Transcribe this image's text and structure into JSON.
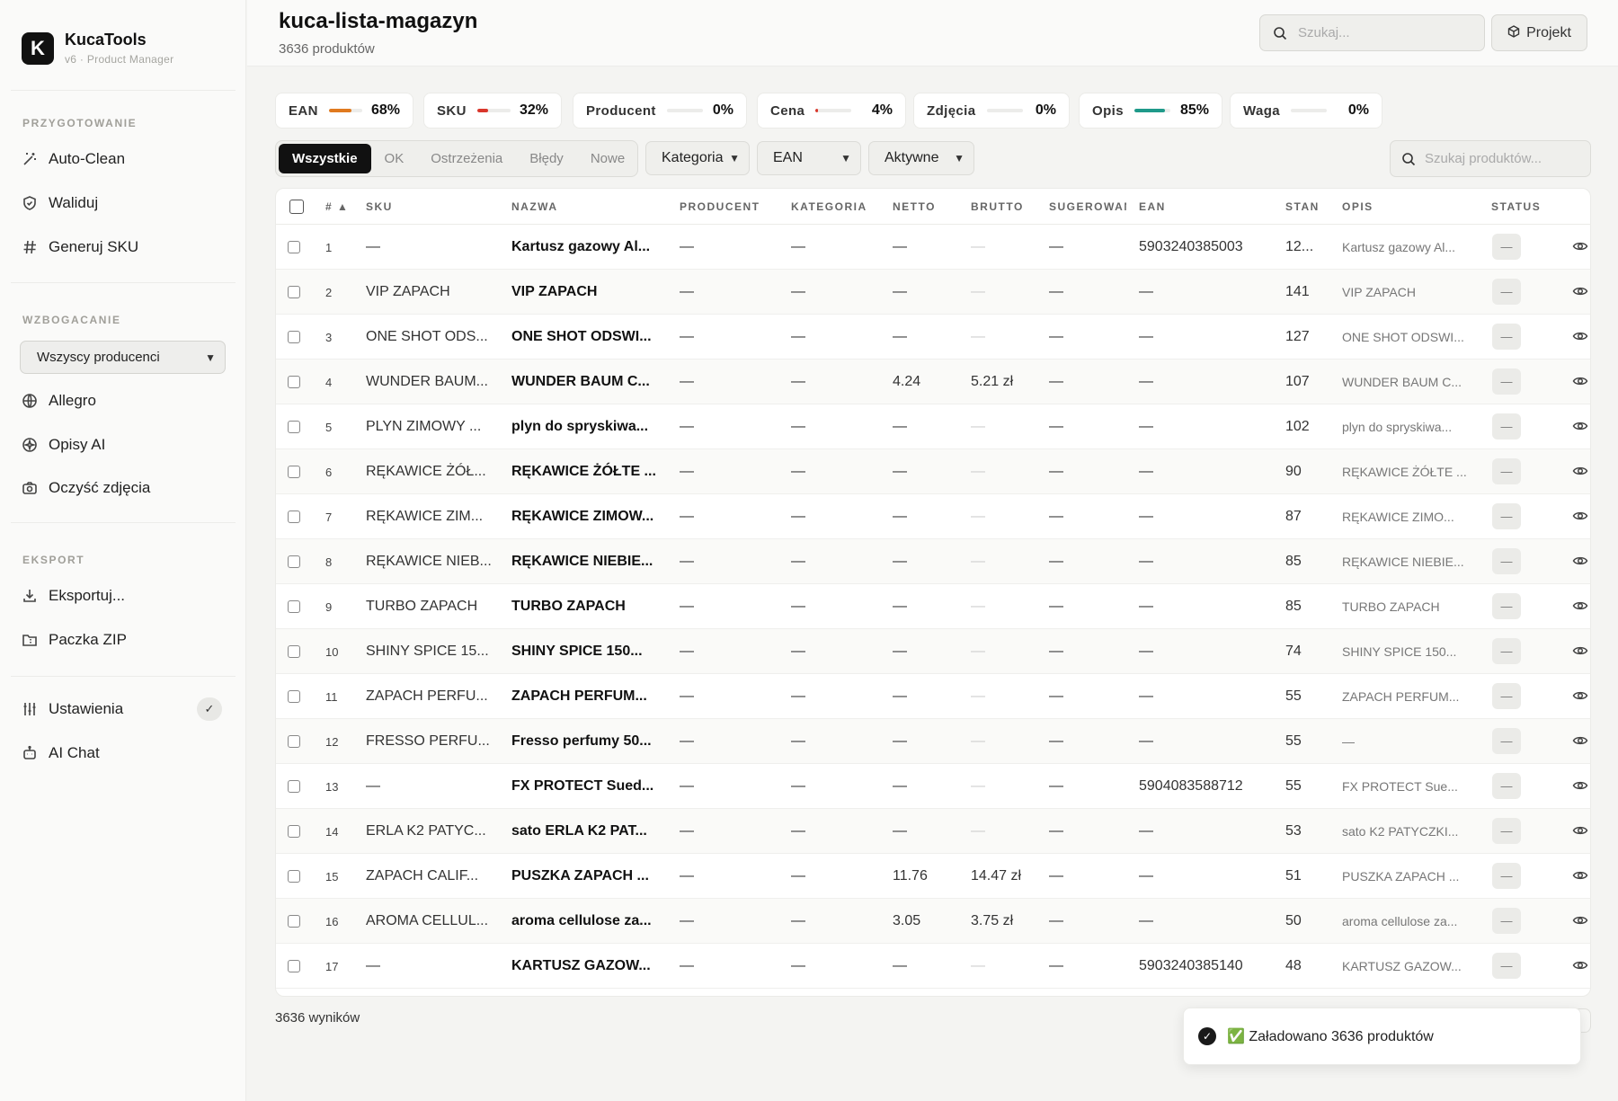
{
  "brand": {
    "logo_letter": "K",
    "title": "KucaTools",
    "subtitle": "v6 · Product Manager"
  },
  "sidebar": {
    "sections": [
      {
        "label": "PRZYGOTOWANIE",
        "items": [
          {
            "label": "Auto-Clean",
            "icon": "magic-wand-icon"
          },
          {
            "label": "Waliduj",
            "icon": "shield-check-icon"
          },
          {
            "label": "Generuj SKU",
            "icon": "hash-icon"
          }
        ]
      },
      {
        "label": "WZBOGACANIE",
        "select": "Wszyscy producenci",
        "items": [
          {
            "label": "Allegro",
            "icon": "globe-icon"
          },
          {
            "label": "Opisy AI",
            "icon": "sparkle-icon"
          },
          {
            "label": "Oczyść zdjęcia",
            "icon": "camera-icon"
          }
        ]
      },
      {
        "label": "EKSPORT",
        "items": [
          {
            "label": "Eksportuj...",
            "icon": "download-icon"
          },
          {
            "label": "Paczka ZIP",
            "icon": "folder-zip-icon"
          }
        ]
      }
    ],
    "bottom": [
      {
        "label": "Ustawienia",
        "icon": "sliders-icon",
        "badge": "✓"
      },
      {
        "label": "AI Chat",
        "icon": "robot-icon"
      }
    ]
  },
  "header": {
    "title": "kuca-lista-magazyn",
    "subtitle": "3636 produktów",
    "search_placeholder": "Szukaj...",
    "project_button": "Projekt"
  },
  "stats": [
    {
      "label": "EAN",
      "pct": "68%",
      "fill": 0.68,
      "color": "#e07a1f"
    },
    {
      "label": "SKU",
      "pct": "32%",
      "fill": 0.32,
      "color": "#d9362b"
    },
    {
      "label": "Producent",
      "pct": "0%",
      "fill": 0.0,
      "color": "#d9362b"
    },
    {
      "label": "Cena",
      "pct": "4%",
      "fill": 0.04,
      "color": "#d9362b"
    },
    {
      "label": "Zdjęcia",
      "pct": "0%",
      "fill": 0.0,
      "color": "#d9362b"
    },
    {
      "label": "Opis",
      "pct": "85%",
      "fill": 0.85,
      "color": "#1f9a8a"
    },
    {
      "label": "Waga",
      "pct": "0%",
      "fill": 0.0,
      "color": "#d9362b"
    }
  ],
  "filters": {
    "tabs": [
      "Wszystkie",
      "OK",
      "Ostrzeżenia",
      "Błędy",
      "Nowe"
    ],
    "active_tab": "Wszystkie",
    "selects": [
      "Kategoria",
      "EAN",
      "Aktywne"
    ],
    "search_placeholder": "Szukaj produktów..."
  },
  "table": {
    "columns": [
      "# ▲",
      "SKU",
      "NAZWA",
      "PRODUCENT",
      "KATEGORIA",
      "NETTO",
      "BRUTTO",
      "SUGEROWANA",
      "EAN",
      "STAN",
      "OPIS",
      "STATUS"
    ],
    "rows": [
      [
        "1",
        "—",
        "Kartusz gazowy Al...",
        "—",
        "—",
        "—",
        "—",
        "—",
        "5903240385003",
        "12...",
        "Kartusz gazowy Al...",
        "—"
      ],
      [
        "2",
        "VIP ZAPACH",
        "VIP ZAPACH",
        "—",
        "—",
        "—",
        "—",
        "—",
        "—",
        "141",
        "VIP ZAPACH",
        "—"
      ],
      [
        "3",
        "ONE SHOT ODS...",
        "ONE SHOT ODSWI...",
        "—",
        "—",
        "—",
        "—",
        "—",
        "—",
        "127",
        "ONE SHOT ODSWI...",
        "—"
      ],
      [
        "4",
        "WUNDER BAUM...",
        "WUNDER BAUM C...",
        "—",
        "—",
        "4.24",
        "5.21 zł",
        "—",
        "—",
        "107",
        "WUNDER BAUM C...",
        "—"
      ],
      [
        "5",
        "PLYN ZIMOWY ...",
        "plyn do spryskiwa...",
        "—",
        "—",
        "—",
        "—",
        "—",
        "—",
        "102",
        "plyn do spryskiwa...",
        "—"
      ],
      [
        "6",
        "RĘKAWICE ŻÓŁ...",
        "RĘKAWICE ŻÓŁTE ...",
        "—",
        "—",
        "—",
        "—",
        "—",
        "—",
        "90",
        "RĘKAWICE ŻÓŁTE ...",
        "—"
      ],
      [
        "7",
        "RĘKAWICE ZIM...",
        "RĘKAWICE ZIMOW...",
        "—",
        "—",
        "—",
        "—",
        "—",
        "—",
        "87",
        "RĘKAWICE ZIMO...",
        "—"
      ],
      [
        "8",
        "RĘKAWICE NIEB...",
        "RĘKAWICE NIEBIE...",
        "—",
        "—",
        "—",
        "—",
        "—",
        "—",
        "85",
        "RĘKAWICE NIEBIE...",
        "—"
      ],
      [
        "9",
        "TURBO ZAPACH",
        "TURBO ZAPACH",
        "—",
        "—",
        "—",
        "—",
        "—",
        "—",
        "85",
        "TURBO ZAPACH",
        "—"
      ],
      [
        "10",
        "SHINY SPICE 15...",
        "SHINY SPICE 150...",
        "—",
        "—",
        "—",
        "—",
        "—",
        "—",
        "74",
        "SHINY SPICE 150...",
        "—"
      ],
      [
        "11",
        "ZAPACH PERFU...",
        "ZAPACH PERFUM...",
        "—",
        "—",
        "—",
        "—",
        "—",
        "—",
        "55",
        "ZAPACH PERFUM...",
        "—"
      ],
      [
        "12",
        "FRESSO PERFU...",
        "Fresso perfumy 50...",
        "—",
        "—",
        "—",
        "—",
        "—",
        "—",
        "55",
        "—",
        "—"
      ],
      [
        "13",
        "—",
        "FX PROTECT Sued...",
        "—",
        "—",
        "—",
        "—",
        "—",
        "5904083588712",
        "55",
        "FX PROTECT Sue...",
        "—"
      ],
      [
        "14",
        "ERLA K2 PATYC...",
        "sato ERLA K2 PAT...",
        "—",
        "—",
        "—",
        "—",
        "—",
        "—",
        "53",
        "sato K2 PATYCZKI...",
        "—"
      ],
      [
        "15",
        "ZAPACH CALIF...",
        "PUSZKA ZAPACH ...",
        "—",
        "—",
        "11.76",
        "14.47 zł",
        "—",
        "—",
        "51",
        "PUSZKA ZAPACH ...",
        "—"
      ],
      [
        "16",
        "AROMA CELLUL...",
        "aroma cellulose za...",
        "—",
        "—",
        "3.05",
        "3.75 zł",
        "—",
        "—",
        "50",
        "aroma cellulose za...",
        "—"
      ],
      [
        "17",
        "—",
        "KARTUSZ GAZOW...",
        "—",
        "—",
        "—",
        "—",
        "—",
        "5903240385140",
        "48",
        "KARTUSZ GAZOW...",
        "—"
      ]
    ]
  },
  "footer": {
    "results": "3636 wyników"
  },
  "toast": {
    "message": "✅ Załadowano 3636 produktów"
  }
}
